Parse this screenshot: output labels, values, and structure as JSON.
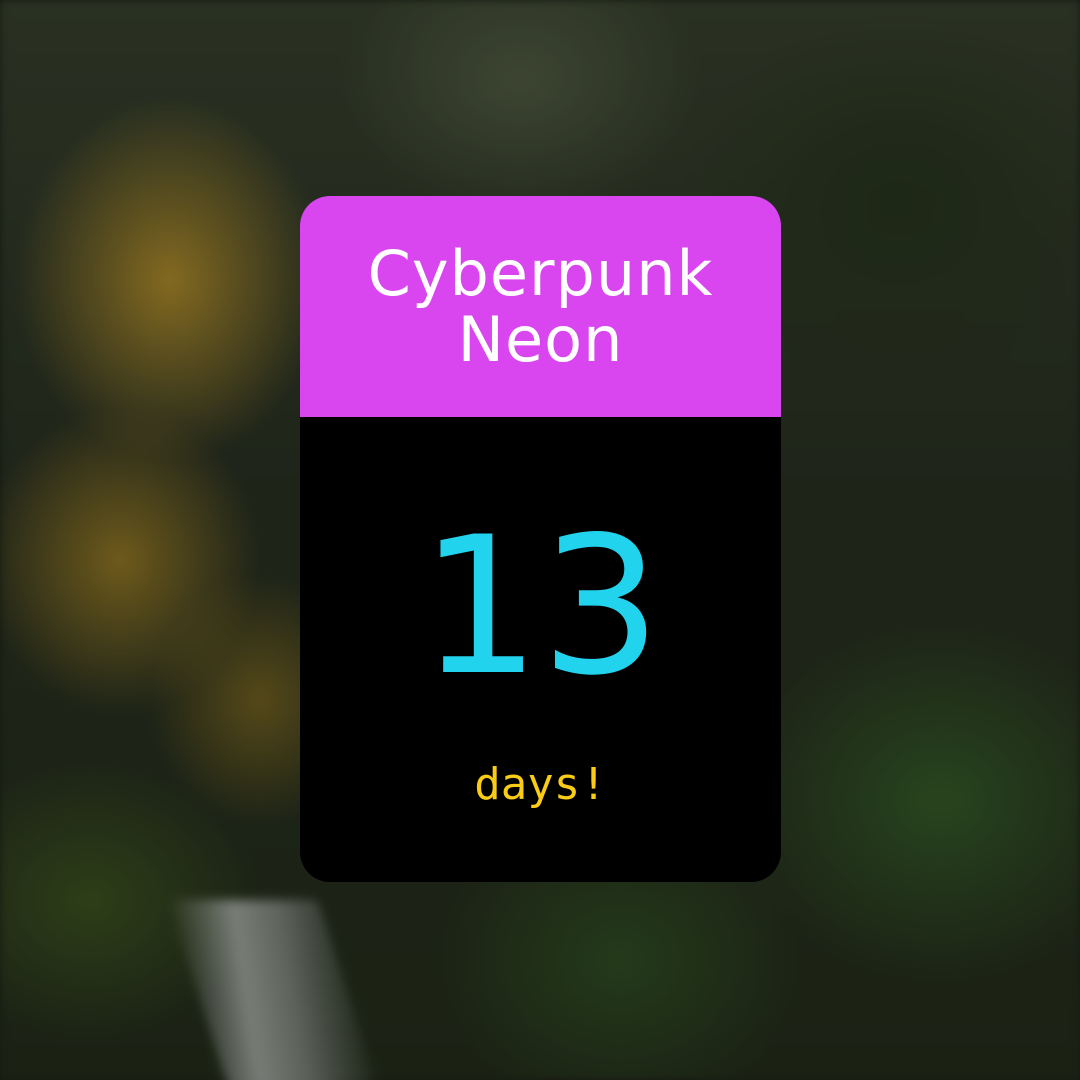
{
  "background": {
    "description_icon": "forest-waterfall-photo"
  },
  "countdown": {
    "title": "Cyberpunk Neon",
    "count": "13",
    "unit": "days!",
    "colors": {
      "header": "#d946ef",
      "body": "#000000",
      "title": "#ffffff",
      "count": "#22d3ee",
      "unit": "#facc15"
    }
  }
}
